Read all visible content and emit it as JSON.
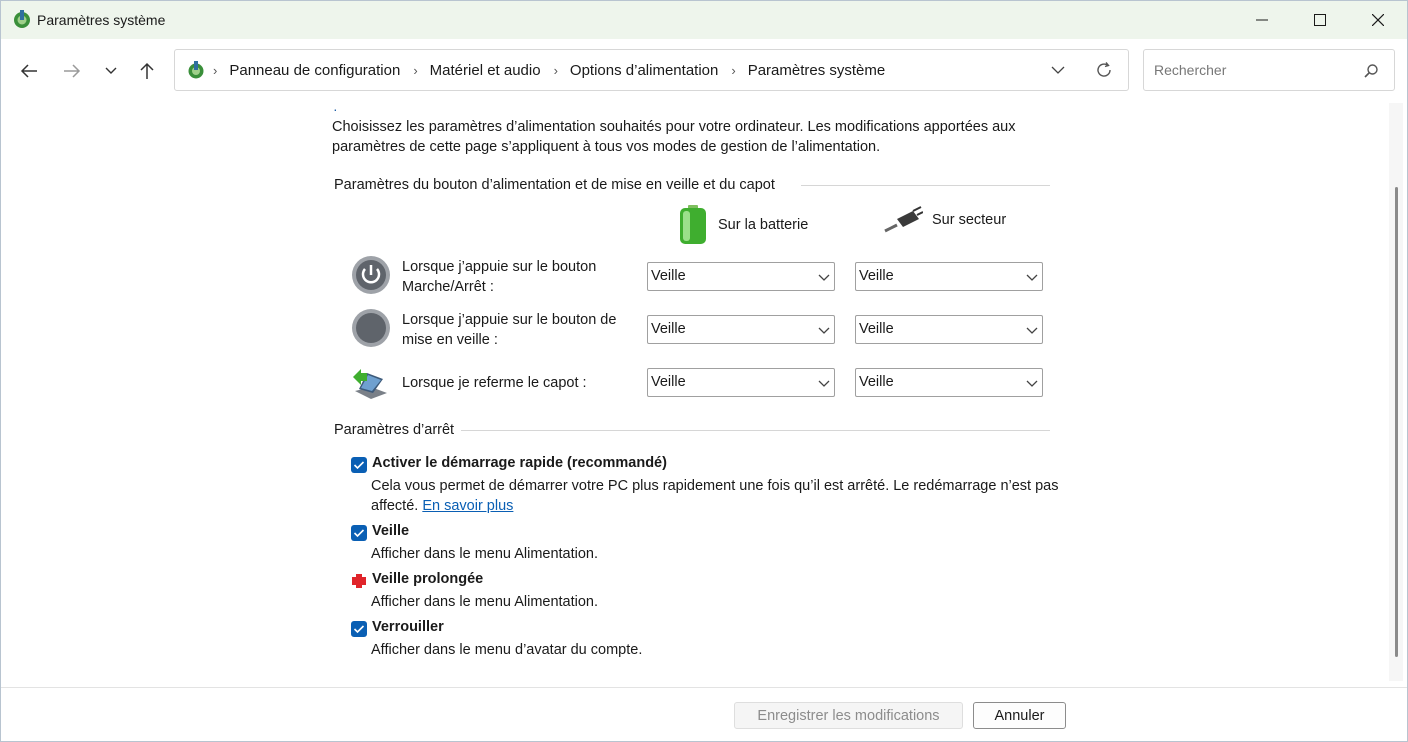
{
  "window": {
    "title": "Paramètres système",
    "icon": "power-options-icon"
  },
  "navigation": {
    "breadcrumbs": [
      {
        "label": "Panneau de configuration"
      },
      {
        "label": "Matériel et audio"
      },
      {
        "label": "Options d’alimentation"
      },
      {
        "label": "Paramètres système"
      }
    ],
    "search_placeholder": "Rechercher"
  },
  "main": {
    "dot": "·",
    "intro": "Choisissez les paramètres d’alimentation souhaités pour votre ordinateur. Les modifications apportées aux paramètres de cette page s’appliquent à tous vos modes de gestion de l’alimentation.",
    "power_section": {
      "title": "Paramètres du bouton d’alimentation et de mise en veille et du capot",
      "col_battery": "Sur la batterie",
      "col_ac": "Sur secteur",
      "rows": [
        {
          "label": "Lorsque j’appuie sur le bouton Marche/Arrêt :",
          "battery": "Veille",
          "ac": "Veille",
          "icon": "power-button-icon"
        },
        {
          "label": "Lorsque j’appuie sur le bouton de mise en veille :",
          "battery": "Veille",
          "ac": "Veille",
          "icon": "sleep-button-icon"
        },
        {
          "label": "Lorsque je referme le capot :",
          "battery": "Veille",
          "ac": "Veille",
          "icon": "laptop-lid-icon"
        }
      ]
    },
    "shutdown_section": {
      "title": "Paramètres d’arrêt",
      "items": [
        {
          "label": "Activer le démarrage rapide (recommandé)",
          "desc": "Cela vous permet de démarrer votre PC plus rapidement une fois qu’il est arrêté. Le redémarrage n’est pas affecté.",
          "link": "En savoir plus",
          "checked": true
        },
        {
          "label": "Veille",
          "desc": "Afficher dans le menu Alimentation.",
          "checked": true
        },
        {
          "label": "Veille prolongée",
          "desc": "Afficher dans le menu Alimentation.",
          "checked": false
        },
        {
          "label": "Verrouiller",
          "desc": "Afficher dans le menu d’avatar du compte.",
          "checked": true
        }
      ]
    }
  },
  "footer": {
    "save_label": "Enregistrer les modifications",
    "cancel_label": "Annuler"
  },
  "colors": {
    "accent": "#0a5fb4",
    "title_bar": "#eef5ec"
  }
}
